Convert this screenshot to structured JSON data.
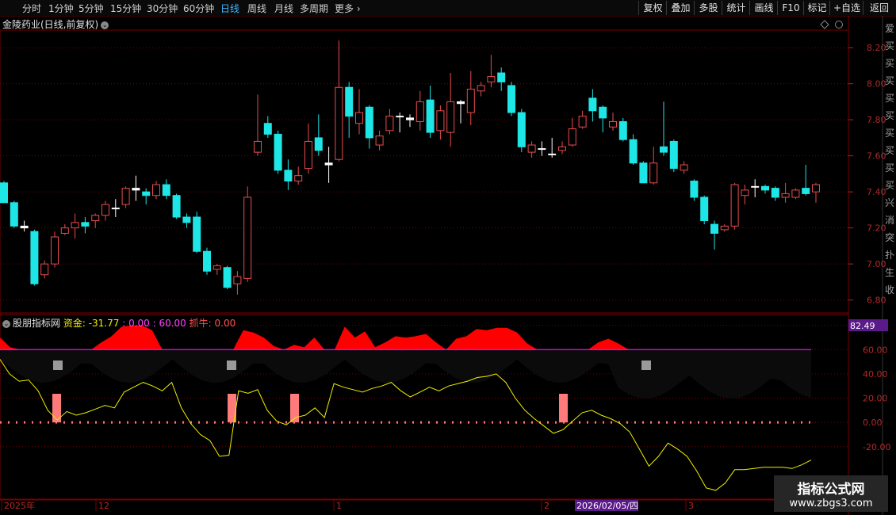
{
  "toolbar": {
    "periods": [
      "分时",
      "1分钟",
      "5分钟",
      "15分钟",
      "30分钟",
      "60分钟",
      "日线",
      "周线",
      "月线",
      "多周期",
      "更多"
    ],
    "active_period": "日线",
    "more_chevron": "›",
    "right_buttons": [
      "复权",
      "叠加",
      "多股",
      "统计",
      "画线",
      "F10",
      "标记",
      "+自选",
      "返回"
    ]
  },
  "main_chart": {
    "title": "金陵药业(日线,前复权)",
    "dropdown_icon": "chevron-down-icon"
  },
  "sub_chart": {
    "title": "股朋指标网",
    "label_zijin": "资金: -31.77",
    "label_mid": " : 0.00 : 60.00",
    "label_zhuaniu": "抓牛: 0.00",
    "highlight_value": "82.49"
  },
  "right_panel_glyphs": [
    "爱",
    "买",
    "买",
    "买",
    "买",
    "买",
    "买",
    "买",
    "买",
    "买",
    "兴",
    "消",
    "突",
    "扑",
    "生",
    "收"
  ],
  "date_bar": {
    "labels": [
      "2025年",
      "12",
      "1",
      "2",
      "2026/02/05/四",
      "3"
    ],
    "cursor_label": "2026/02/05/四"
  },
  "watermark": {
    "line1": "指标公式网",
    "line2": "www.zbgs3.com"
  },
  "colors": {
    "up": "#e84c4c",
    "down": "#1ee6e6",
    "grid": "#7a0000",
    "axis_text": "#b42828",
    "yellow": "#f0f000",
    "magenta": "#ff00ff",
    "red_fill": "#ff0000",
    "pink_bar": "#ff7a7a"
  },
  "chart_data": [
    {
      "type": "candlestick",
      "title": "金陵药业(日线,前复权)",
      "yticks": [
        8.2,
        8.0,
        7.8,
        7.6,
        7.4,
        7.2,
        7.0,
        6.8
      ],
      "ylim": [
        6.75,
        8.28
      ],
      "candles": [
        [
          7.45,
          7.34,
          7.46,
          7.34
        ],
        [
          7.34,
          7.21,
          7.35,
          7.2
        ],
        [
          7.2,
          7.21,
          7.24,
          7.18
        ],
        [
          7.18,
          6.89,
          7.19,
          6.88
        ],
        [
          6.94,
          7.0,
          7.02,
          6.92
        ],
        [
          7.0,
          7.15,
          7.18,
          6.98
        ],
        [
          7.17,
          7.2,
          7.22,
          7.16
        ],
        [
          7.2,
          7.23,
          7.28,
          7.14
        ],
        [
          7.23,
          7.21,
          7.26,
          7.17
        ],
        [
          7.24,
          7.27,
          7.28,
          7.2
        ],
        [
          7.27,
          7.33,
          7.35,
          7.24
        ],
        [
          7.31,
          7.31,
          7.36,
          7.26
        ],
        [
          7.33,
          7.42,
          7.43,
          7.31
        ],
        [
          7.41,
          7.42,
          7.49,
          7.35
        ],
        [
          7.4,
          7.38,
          7.42,
          7.33
        ],
        [
          7.38,
          7.44,
          7.46,
          7.36
        ],
        [
          7.44,
          7.38,
          7.47,
          7.36
        ],
        [
          7.38,
          7.26,
          7.39,
          7.25
        ],
        [
          7.26,
          7.23,
          7.28,
          7.2
        ],
        [
          7.26,
          7.07,
          7.29,
          7.06
        ],
        [
          7.07,
          6.96,
          7.09,
          6.94
        ],
        [
          6.97,
          6.99,
          7.0,
          6.94
        ],
        [
          6.98,
          6.87,
          6.99,
          6.86
        ],
        [
          6.89,
          6.93,
          6.96,
          6.83
        ],
        [
          6.92,
          7.37,
          7.43,
          6.9
        ],
        [
          7.62,
          7.68,
          7.94,
          7.6
        ],
        [
          7.78,
          7.72,
          7.82,
          7.7
        ],
        [
          7.72,
          7.52,
          7.74,
          7.5
        ],
        [
          7.52,
          7.46,
          7.58,
          7.41
        ],
        [
          7.46,
          7.49,
          7.54,
          7.44
        ],
        [
          7.53,
          7.68,
          7.78,
          7.5
        ],
        [
          7.7,
          7.63,
          7.83,
          7.6
        ],
        [
          7.56,
          7.55,
          7.65,
          7.45
        ],
        [
          7.58,
          7.98,
          8.24,
          7.57
        ],
        [
          7.98,
          7.82,
          8.01,
          7.7
        ],
        [
          7.78,
          7.84,
          7.97,
          7.72
        ],
        [
          7.87,
          7.7,
          7.88,
          7.64
        ],
        [
          7.66,
          7.71,
          7.74,
          7.63
        ],
        [
          7.74,
          7.82,
          7.86,
          7.72
        ],
        [
          7.82,
          7.82,
          7.84,
          7.73
        ],
        [
          7.81,
          7.8,
          7.83,
          7.76
        ],
        [
          7.79,
          7.9,
          7.96,
          7.74
        ],
        [
          7.91,
          7.73,
          7.99,
          7.7
        ],
        [
          7.74,
          7.85,
          7.88,
          7.69
        ],
        [
          7.73,
          7.9,
          8.06,
          7.65
        ],
        [
          7.9,
          7.89,
          7.91,
          7.78
        ],
        [
          7.84,
          7.97,
          8.07,
          7.77
        ],
        [
          7.96,
          7.99,
          8.01,
          7.93
        ],
        [
          8.01,
          8.04,
          8.16,
          7.98
        ],
        [
          8.06,
          8.01,
          8.09,
          7.96
        ],
        [
          7.99,
          7.84,
          8.01,
          7.82
        ],
        [
          7.84,
          7.65,
          7.86,
          7.62
        ],
        [
          7.62,
          7.66,
          7.68,
          7.59
        ],
        [
          7.64,
          7.64,
          7.68,
          7.6
        ],
        [
          7.61,
          7.61,
          7.7,
          7.59
        ],
        [
          7.63,
          7.65,
          7.68,
          7.61
        ],
        [
          7.66,
          7.75,
          7.81,
          7.65
        ],
        [
          7.76,
          7.82,
          7.85,
          7.75
        ],
        [
          7.92,
          7.85,
          7.97,
          7.79
        ],
        [
          7.87,
          7.81,
          7.88,
          7.73
        ],
        [
          7.76,
          7.79,
          7.84,
          7.74
        ],
        [
          7.79,
          7.69,
          7.81,
          7.68
        ],
        [
          7.69,
          7.56,
          7.72,
          7.55
        ],
        [
          7.56,
          7.45,
          7.57,
          7.45
        ],
        [
          7.45,
          7.56,
          7.65,
          7.44
        ],
        [
          7.65,
          7.62,
          7.9,
          7.6
        ],
        [
          7.68,
          7.53,
          7.69,
          7.51
        ],
        [
          7.52,
          7.55,
          7.57,
          7.5
        ],
        [
          7.46,
          7.37,
          7.47,
          7.35
        ],
        [
          7.37,
          7.24,
          7.38,
          7.22
        ],
        [
          7.22,
          7.17,
          7.24,
          7.08
        ],
        [
          7.19,
          7.21,
          7.22,
          7.18
        ],
        [
          7.21,
          7.44,
          7.45,
          7.19
        ],
        [
          7.38,
          7.41,
          7.44,
          7.33
        ],
        [
          7.43,
          7.43,
          7.47,
          7.37
        ],
        [
          7.43,
          7.41,
          7.44,
          7.39
        ],
        [
          7.42,
          7.37,
          7.43,
          7.35
        ],
        [
          7.37,
          7.39,
          7.45,
          7.34
        ],
        [
          7.37,
          7.41,
          7.42,
          7.36
        ],
        [
          7.42,
          7.39,
          7.55,
          7.38
        ],
        [
          7.4,
          7.44,
          7.45,
          7.34
        ]
      ]
    },
    {
      "type": "area",
      "title": "股朋指标网",
      "yticks": [
        80.0,
        60.0,
        40.0,
        20.0,
        0.0,
        -20.0
      ],
      "ylim": [
        -60,
        85
      ],
      "baseline": 60,
      "zijin": [
        {
          "x": 0,
          "y": -31.77
        }
      ],
      "red_area_top": [
        70,
        62,
        60,
        60,
        60,
        60,
        60,
        60,
        60,
        60,
        66,
        71,
        79,
        80,
        80,
        76,
        60,
        60,
        60,
        60,
        60,
        60,
        60,
        60,
        76,
        74,
        70,
        63,
        60,
        64,
        62,
        70,
        60,
        60,
        79,
        70,
        75,
        62,
        66,
        71,
        70,
        71,
        73,
        66,
        60,
        69,
        71,
        77,
        76,
        78,
        78,
        74,
        65,
        60,
        60,
        60,
        60,
        60,
        60,
        66,
        69,
        65,
        60,
        60,
        60,
        60,
        60,
        60,
        60,
        60,
        60,
        60,
        60,
        60,
        60,
        60,
        60,
        60,
        60,
        60,
        60
      ],
      "yellow_line": [
        52,
        40,
        34,
        35,
        26,
        10,
        2,
        9,
        6,
        8,
        11,
        14,
        12,
        25,
        29,
        33,
        30,
        26,
        33,
        12,
        -1,
        -10,
        -15,
        -28,
        -27,
        26,
        24,
        27,
        10,
        1,
        -2,
        4,
        6,
        12,
        4,
        32,
        29,
        27,
        25,
        28,
        30,
        33,
        26,
        21,
        25,
        29,
        26,
        30,
        32,
        34,
        37,
        38,
        40,
        33,
        20,
        10,
        3,
        -3,
        -9,
        -6,
        1,
        8,
        10,
        6,
        3,
        -1,
        -8,
        -22,
        -36,
        -28,
        -17,
        -22,
        -28,
        -40,
        -54,
        -56,
        -50,
        -39,
        -39,
        -38,
        -37,
        -37,
        -37,
        -38,
        -35,
        -31
      ]
    }
  ]
}
